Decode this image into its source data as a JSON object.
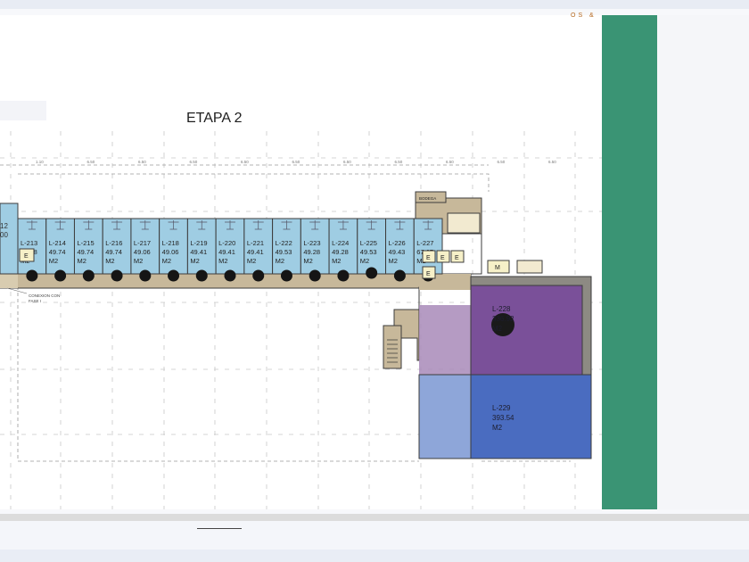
{
  "plan": {
    "title": "ETAPA 2",
    "corner_label": "OS &",
    "labels": {
      "connection": "CONEXION CON",
      "connection_sub": "FASE I",
      "storage": "BODEGA",
      "elevator": "E",
      "machine_room": "M",
      "left_partial_top": "12",
      "left_partial_bottom": "00"
    },
    "dimensions": [
      "1.10",
      "6.50",
      "6.50",
      "6.50",
      "6.50",
      "6.50",
      "6.50",
      "6.50",
      "6.50",
      "6.50",
      "6.50"
    ],
    "units": [
      {
        "id": "L-213",
        "area": "71.88",
        "unit": "M2"
      },
      {
        "id": "L-214",
        "area": "49.74",
        "unit": "M2"
      },
      {
        "id": "L-215",
        "area": "49.74",
        "unit": "M2"
      },
      {
        "id": "L-216",
        "area": "49.74",
        "unit": "M2"
      },
      {
        "id": "L-217",
        "area": "49.06",
        "unit": "M2"
      },
      {
        "id": "L-218",
        "area": "49.06",
        "unit": "M2"
      },
      {
        "id": "L-219",
        "area": "49.41",
        "unit": "M2"
      },
      {
        "id": "L-220",
        "area": "49.41",
        "unit": "M2"
      },
      {
        "id": "L-221",
        "area": "49.41",
        "unit": "M2"
      },
      {
        "id": "L-222",
        "area": "49.53",
        "unit": "M2"
      },
      {
        "id": "L-223",
        "area": "49.28",
        "unit": "M2"
      },
      {
        "id": "L-224",
        "area": "49.28",
        "unit": "M2"
      },
      {
        "id": "L-225",
        "area": "49.53",
        "unit": "M2"
      },
      {
        "id": "L-226",
        "area": "49.43",
        "unit": "M2"
      },
      {
        "id": "L-227",
        "area": "67.67",
        "unit": "M2"
      }
    ],
    "large_units": [
      {
        "id": "L-228",
        "area": "336.92",
        "unit": "M2"
      },
      {
        "id": "L-229",
        "area": "393.54",
        "unit": "M2"
      }
    ],
    "colors": {
      "small_unit": "#9fcde3",
      "corridor": "#c7b89a",
      "unit_228": "#7a5099",
      "unit_229": "#4a6cc0",
      "wall": "#3c3c3c",
      "side_panel": "#3a9474"
    }
  }
}
